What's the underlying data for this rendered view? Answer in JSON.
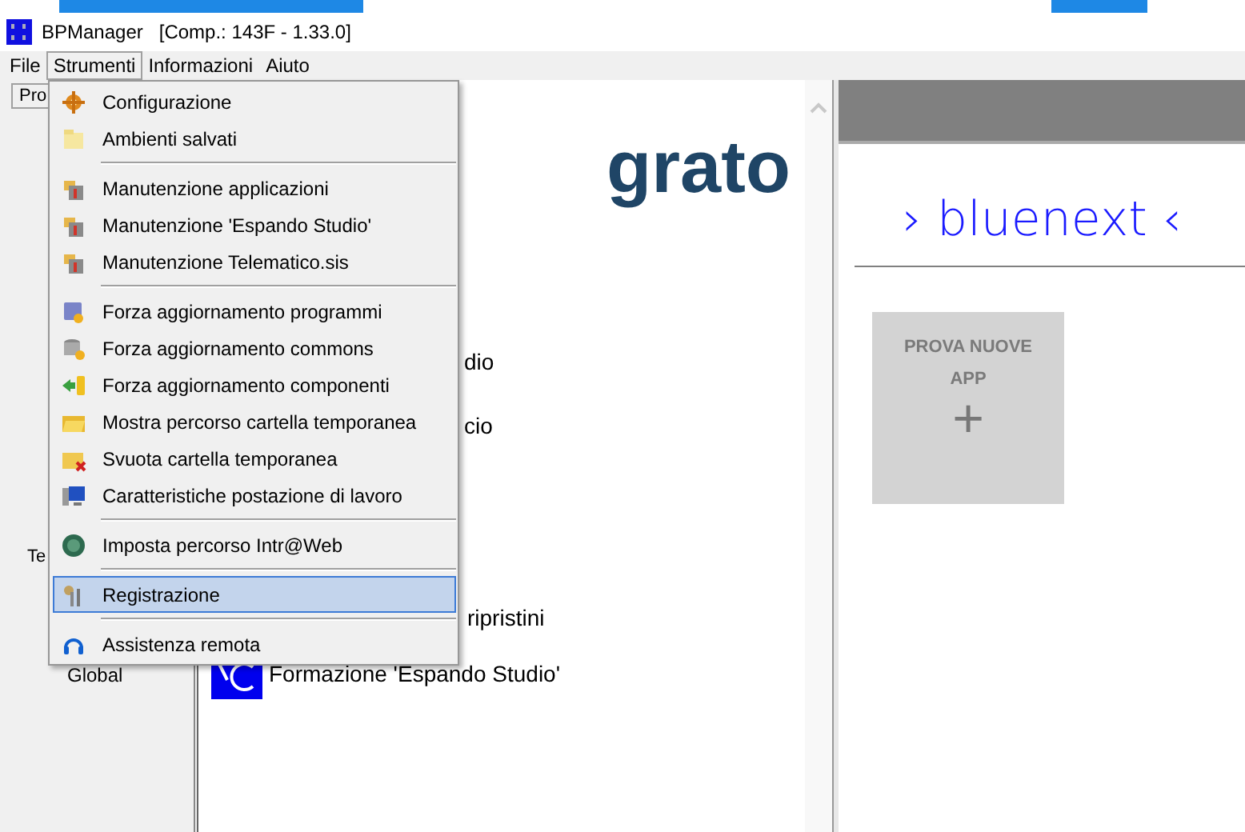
{
  "window": {
    "title": "BPManager",
    "subtitle": "[Comp.: 143F - 1.33.0]"
  },
  "menu_bar": [
    {
      "label": "File",
      "selected": false
    },
    {
      "label": "Strumenti",
      "selected": true
    },
    {
      "label": "Informazioni",
      "selected": false
    },
    {
      "label": "Aiuto",
      "selected": false
    }
  ],
  "left_panel": {
    "tab": "Pro",
    "texts": [
      "Te",
      "Global"
    ]
  },
  "main_panel": {
    "heading": "grato",
    "entries": [
      "dio",
      "cio",
      "ripristini",
      "Formazione 'Espando Studio'"
    ]
  },
  "right_panel": {
    "logo_text": "› bluenext ‹",
    "tile": {
      "label": "PROVA NUOVE APP",
      "symbol": "+"
    }
  },
  "dropdown": {
    "groups": [
      [
        {
          "label": "Configurazione",
          "selected": false
        },
        {
          "label": "Ambienti salvati",
          "selected": false
        }
      ],
      [
        {
          "label": "Manutenzione applicazioni",
          "selected": false
        },
        {
          "label": "Manutenzione 'Espando Studio'",
          "selected": false
        },
        {
          "label": "Manutenzione Telematico.sis",
          "selected": false
        }
      ],
      [
        {
          "label": "Forza aggiornamento programmi",
          "selected": false
        },
        {
          "label": "Forza aggiornamento commons",
          "selected": false
        },
        {
          "label": "Forza aggiornamento componenti",
          "selected": false
        },
        {
          "label": "Mostra percorso cartella temporanea",
          "selected": false
        },
        {
          "label": "Svuota cartella temporanea",
          "selected": false
        },
        {
          "label": "Caratteristiche postazione di lavoro",
          "selected": false
        }
      ],
      [
        {
          "label": "Imposta percorso Intr@Web",
          "selected": false
        }
      ],
      [
        {
          "label": "Registrazione",
          "selected": true
        }
      ],
      [
        {
          "label": "Assistenza remota",
          "selected": false
        }
      ]
    ]
  }
}
